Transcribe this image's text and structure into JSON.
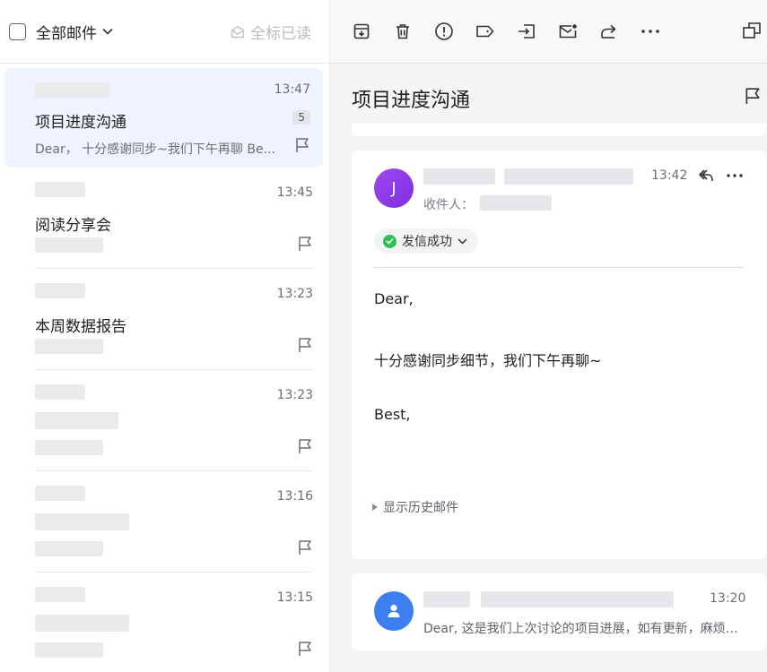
{
  "list_header": {
    "select_all_label": "全部邮件",
    "mark_all_read_label": "全标已读"
  },
  "mails": [
    {
      "time": "13:47",
      "subject": "项目进度沟通",
      "preview": "Dear， 十分感谢同步~我们下午再聊 Be...",
      "count": "5",
      "selected": true
    },
    {
      "time": "13:45",
      "subject": "阅读分享会",
      "preview": "",
      "selected": false
    },
    {
      "time": "13:23",
      "subject": "本周数据报告",
      "preview": "",
      "selected": false
    },
    {
      "time": "13:23",
      "subject": "",
      "preview": "",
      "selected": false
    },
    {
      "time": "13:16",
      "subject": "",
      "preview": "",
      "selected": false
    },
    {
      "time": "13:15",
      "subject": "",
      "preview": "",
      "selected": false
    }
  ],
  "toolbar_icons": [
    "archive-icon",
    "trash-icon",
    "report-spam-icon",
    "label-icon",
    "move-to-icon",
    "mark-unread-icon",
    "forward-icon",
    "more-icon"
  ],
  "thread": {
    "title": "项目进度沟通"
  },
  "message1": {
    "avatar_letter": "J",
    "time": "13:42",
    "recipients_label": "收件人：",
    "status": "发信成功",
    "body": [
      "Dear,",
      "十分感谢同步细节，我们下午再聊~",
      "Best,"
    ],
    "history_label": "显示历史邮件"
  },
  "message2": {
    "time": "13:20",
    "snippet": "Dear, 这是我们上次讨论的项目进展，如有更新，麻烦同步一下"
  },
  "colors": {
    "selected_bg": "#eef3ff",
    "avatar_purple": "#8a3be8",
    "avatar_blue": "#3d7ff0",
    "success_green": "#2ec055"
  }
}
